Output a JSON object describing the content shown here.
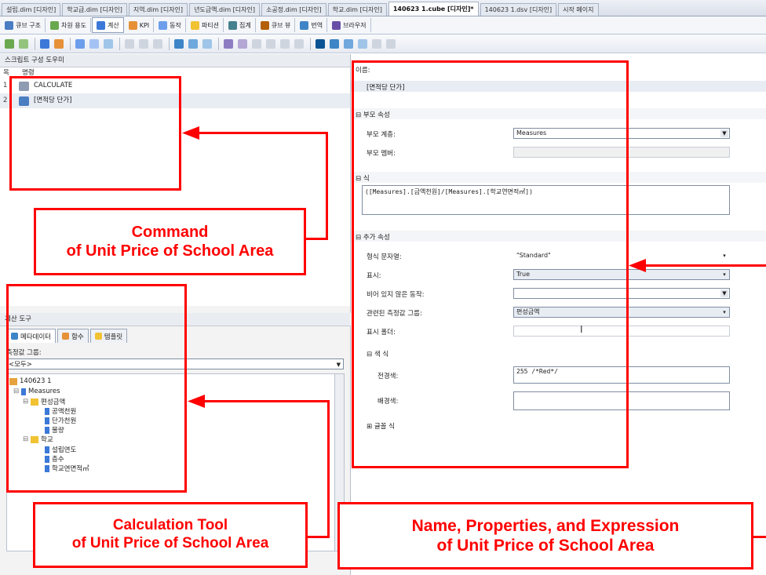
{
  "doc_tabs": [
    "설립.dim [디자인]",
    "학교급.dim [디자인]",
    "지역.dim [디자인]",
    "년도금액.dim [디자인]",
    "소공정.dim [디자인]",
    "학교.dim [디자인]",
    "140623 1.cube [디자인]*",
    "140623 1.dsv [디자인]",
    "시작 페이지"
  ],
  "designer_tabs": [
    "큐브 구조",
    "차원 용도",
    "계산",
    "KPI",
    "동작",
    "파티션",
    "집계",
    "큐브 뷰",
    "번역",
    "브라우저"
  ],
  "script_helper": {
    "title": "스크립트 구성 도우미",
    "header_num": "옥",
    "header_cmd": "명령",
    "rows": [
      {
        "num": "1",
        "text": "CALCULATE"
      },
      {
        "num": "2",
        "text": "[면적당 단가]"
      }
    ]
  },
  "calc_tools": {
    "title": "계산 도구",
    "tabs": [
      "메타데이터",
      "함수",
      "템플릿"
    ],
    "measure_group_label": "측정값 그룹:",
    "measure_group_value": "<모두>",
    "tree": [
      "140623 1",
      "Measures",
      "편성금액",
      "공액천원",
      "단가천원",
      "물량",
      "학교",
      "설립연도",
      "층수",
      "학교연면적㎡"
    ]
  },
  "form": {
    "name_label": "이름:",
    "name_value": "[면적당 단가]",
    "parent_section": "부모 속성",
    "parent_hierarchy_label": "부모 계층:",
    "parent_hierarchy_value": "Measures",
    "parent_member_label": "부모 멤버:",
    "parent_member_value": "",
    "expression_section": "식",
    "expression_value": "([Measures].[금액천원]/[Measures].[학교연면적㎡])",
    "additional_section": "추가 속성",
    "format_label": "형식 문자열:",
    "format_value": "\"Standard\"",
    "visible_label": "표시:",
    "visible_value": "True",
    "nonempty_label": "비어 있지 않은 동작:",
    "nonempty_value": "",
    "assoc_label": "관련된 측정값 그룹:",
    "assoc_value": "편성금액",
    "display_folder_label": "표시 폴더:",
    "display_folder_value": "",
    "color_section": "색 식",
    "forecolor_label": "전경색:",
    "forecolor_value": "255 /*Red*/",
    "backcolor_label": "배경색:",
    "backcolor_value": "",
    "font_section": "글꼴 식"
  },
  "annotations": {
    "command": [
      "Command",
      "of Unit Price of School Area"
    ],
    "calc_tool": [
      "Calculation Tool",
      "of Unit Price of School Area"
    ],
    "properties": [
      "Name, Properties, and Expression",
      "of Unit Price of School Area"
    ]
  },
  "colors": {
    "annotation": "#ff0000",
    "selection_band": "#e8ecf3",
    "section_band": "#f4f5f8"
  }
}
